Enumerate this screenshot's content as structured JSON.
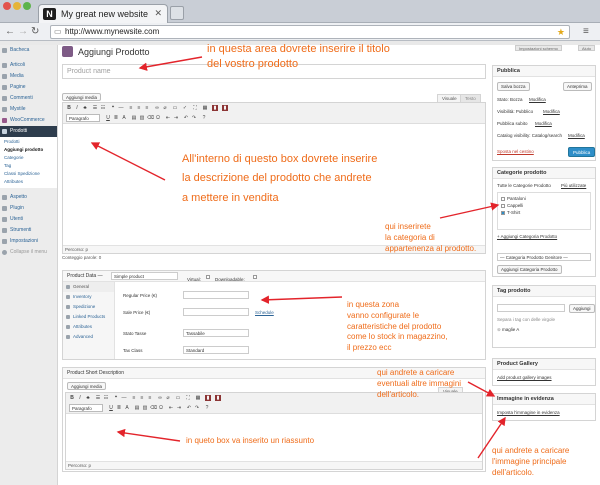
{
  "browser": {
    "tab_logo": "N",
    "tab_title": "My great new website",
    "url": "http://www.mynewsite.com"
  },
  "sidebar": {
    "items": [
      {
        "label": "Bacheca"
      },
      {
        "label": "Articoli"
      },
      {
        "label": "Media"
      },
      {
        "label": "Pagine"
      },
      {
        "label": "Commenti"
      },
      {
        "label": "Mystile"
      },
      {
        "label": "WooCommerce"
      },
      {
        "label": "Prodotti"
      },
      {
        "label": "Aspetto"
      },
      {
        "label": "Plugin"
      },
      {
        "label": "Utenti"
      },
      {
        "label": "Strumenti"
      },
      {
        "label": "Impostazioni"
      },
      {
        "label": "Collapse il menu"
      }
    ],
    "submenu": [
      {
        "label": "Prodotti"
      },
      {
        "label": "Aggiungi prodotto"
      },
      {
        "label": "Categorie"
      },
      {
        "label": "Tag"
      },
      {
        "label": "Classi Spedizione"
      },
      {
        "label": "Attributes"
      }
    ]
  },
  "main": {
    "page_title": "Aggiungi Prodotto",
    "screen_options": "Impostazioni schermo",
    "help": "Aiuto",
    "title_placeholder": "Product name",
    "add_media_label": "Aggiungi media",
    "tab_visual": "Visuale",
    "tab_text": "Testo",
    "format_select": "Paragrafo",
    "path_label": "Percorso: p",
    "word_count": "Conteggio parole: 0"
  },
  "product_data": {
    "header_label": "Product Data —",
    "type_select": "Simple product",
    "virtual_label": "Virtual:",
    "downloadable_label": "Downloadable:",
    "tabs": [
      {
        "label": "General"
      },
      {
        "label": "Inventory"
      },
      {
        "label": "Spedizione"
      },
      {
        "label": "Linked Products"
      },
      {
        "label": "Attributes"
      },
      {
        "label": "Advanced"
      }
    ],
    "regular_price_label": "Regular Price (€)",
    "sale_price_label": "Sale Price (€)",
    "schedule_link": "Schedule",
    "tax_status_label": "Stato Tasse",
    "tax_status_value": "Tassabile",
    "tax_class_label": "Tax Class",
    "tax_class_value": "Standard"
  },
  "short_description": {
    "header": "Product Short Description",
    "add_media_label": "Aggiungi media",
    "tab_visual": "Visuale",
    "format_select": "Paragrafo",
    "path_label": "Percorso: p"
  },
  "publish": {
    "header": "Pubblica",
    "save_draft": "Salva bozza",
    "preview": "Anteprima",
    "status_label": "Stato: Bozza",
    "status_edit": "Modifica",
    "visibility_label": "Visibilità: Pubblico",
    "visibility_edit": "Modifica",
    "publish_when": "Pubblica subito",
    "publish_when_edit": "Modifica",
    "catalog_visibility": "Catalog visibility: Catalog/search",
    "catalog_edit": "Modifica",
    "trash_link": "Sposta nel cestino",
    "publish_button": "Pubblica"
  },
  "categories": {
    "header": "Categorie prodotto",
    "tab_all": "Tutte le Categorie Prodotto",
    "tab_popular": "Più utilizzate",
    "items": [
      {
        "label": "Pantaloni",
        "checked": false
      },
      {
        "label": "Cappelli",
        "checked": false
      },
      {
        "label": "T-Shirt",
        "checked": true
      }
    ],
    "add_link": "+ Aggiungi Categoria Prodotto",
    "parent_select": "— Categoria Prodotto Genitore —",
    "add_button": "Aggiungi Categoria Prodotto"
  },
  "tags": {
    "header": "Tag prodotto",
    "add_button": "Aggiungi",
    "hint": "Separa i tag con delle virgole",
    "tag": "maglie A"
  },
  "gallery": {
    "header": "Product Gallery",
    "add_link": "Add product gallery images"
  },
  "featured": {
    "header": "Immagine in evidenza",
    "set_link": "Imposta l'immagine in evidenza"
  },
  "annotations": {
    "title_area": [
      "in questa area dovrete inserire il titolo",
      "del vostro prodotto"
    ],
    "description": [
      "All'interno di questo box dovrete inserire",
      "la descrizione del prodotto che andrete",
      "a mettere in vendita"
    ],
    "category": [
      "qui inserirete",
      "la categoria di",
      "appartenenza al prodotto."
    ],
    "product_data": [
      "in questa zona",
      "vanno configurate le",
      "caratteristiche del prodotto",
      "come lo stock in magazzino,",
      "il prezzo ecc"
    ],
    "gallery": [
      "qui andrete a caricare",
      "eventuali altre immagini",
      "dell'articolo."
    ],
    "summary": [
      "in queto box va inserito un riassunto"
    ],
    "featured": [
      "qui andrete a caricare",
      "l'immagine principale",
      "dell'articolo."
    ]
  },
  "colors": {
    "annotation": "#ef6c1a",
    "link": "#2d6496",
    "sidebar_active": "#2e3d4d",
    "publish_blue": "#2e8ec8",
    "arrow_red": "#e3242b"
  }
}
